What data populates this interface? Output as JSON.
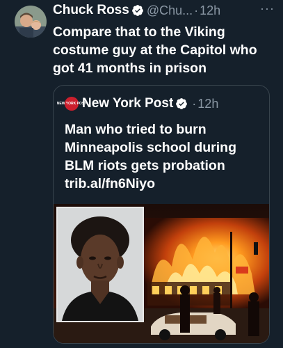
{
  "tweet": {
    "author_name": "Chuck Ross",
    "author_handle": "@Chu...",
    "separator": "·",
    "time": "12h",
    "more_label": "···",
    "text": "Compare that to the Viking costume guy at the Capitol who got 41 months in prison"
  },
  "quoted": {
    "author_name": "New York Post",
    "separator": "·",
    "time": "12h",
    "logo_text": "NEW YORK POST",
    "text": "Man who tried to burn Minneapolis school during BLM riots gets probation",
    "link": "trib.al/fn6Niyo"
  },
  "icons": {
    "verified": "verified-badge-icon",
    "more": "more-options-icon"
  },
  "colors": {
    "background": "#15202b",
    "text": "#ffffff",
    "secondary_text": "#8b98a5",
    "border": "#38444d",
    "nyp_red": "#cc1f2d"
  }
}
